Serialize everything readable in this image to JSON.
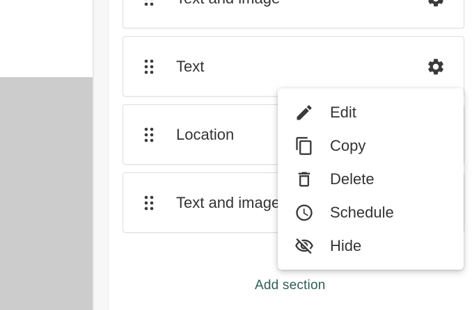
{
  "sections": [
    {
      "label": "Text and image"
    },
    {
      "label": "Text"
    },
    {
      "label": "Location"
    },
    {
      "label": "Text and image"
    }
  ],
  "context_menu": {
    "items": [
      {
        "label": "Edit",
        "icon": "pencil-icon"
      },
      {
        "label": "Copy",
        "icon": "copy-icon"
      },
      {
        "label": "Delete",
        "icon": "trash-icon"
      },
      {
        "label": "Schedule",
        "icon": "clock-icon"
      },
      {
        "label": "Hide",
        "icon": "eye-off-icon"
      }
    ]
  },
  "add_section_label": "Add section",
  "colors": {
    "text": "#333333",
    "icon": "#3a3a3a",
    "accent": "#2f5d53",
    "preview_gray": "#cccccc",
    "card_border": "#dedede"
  }
}
